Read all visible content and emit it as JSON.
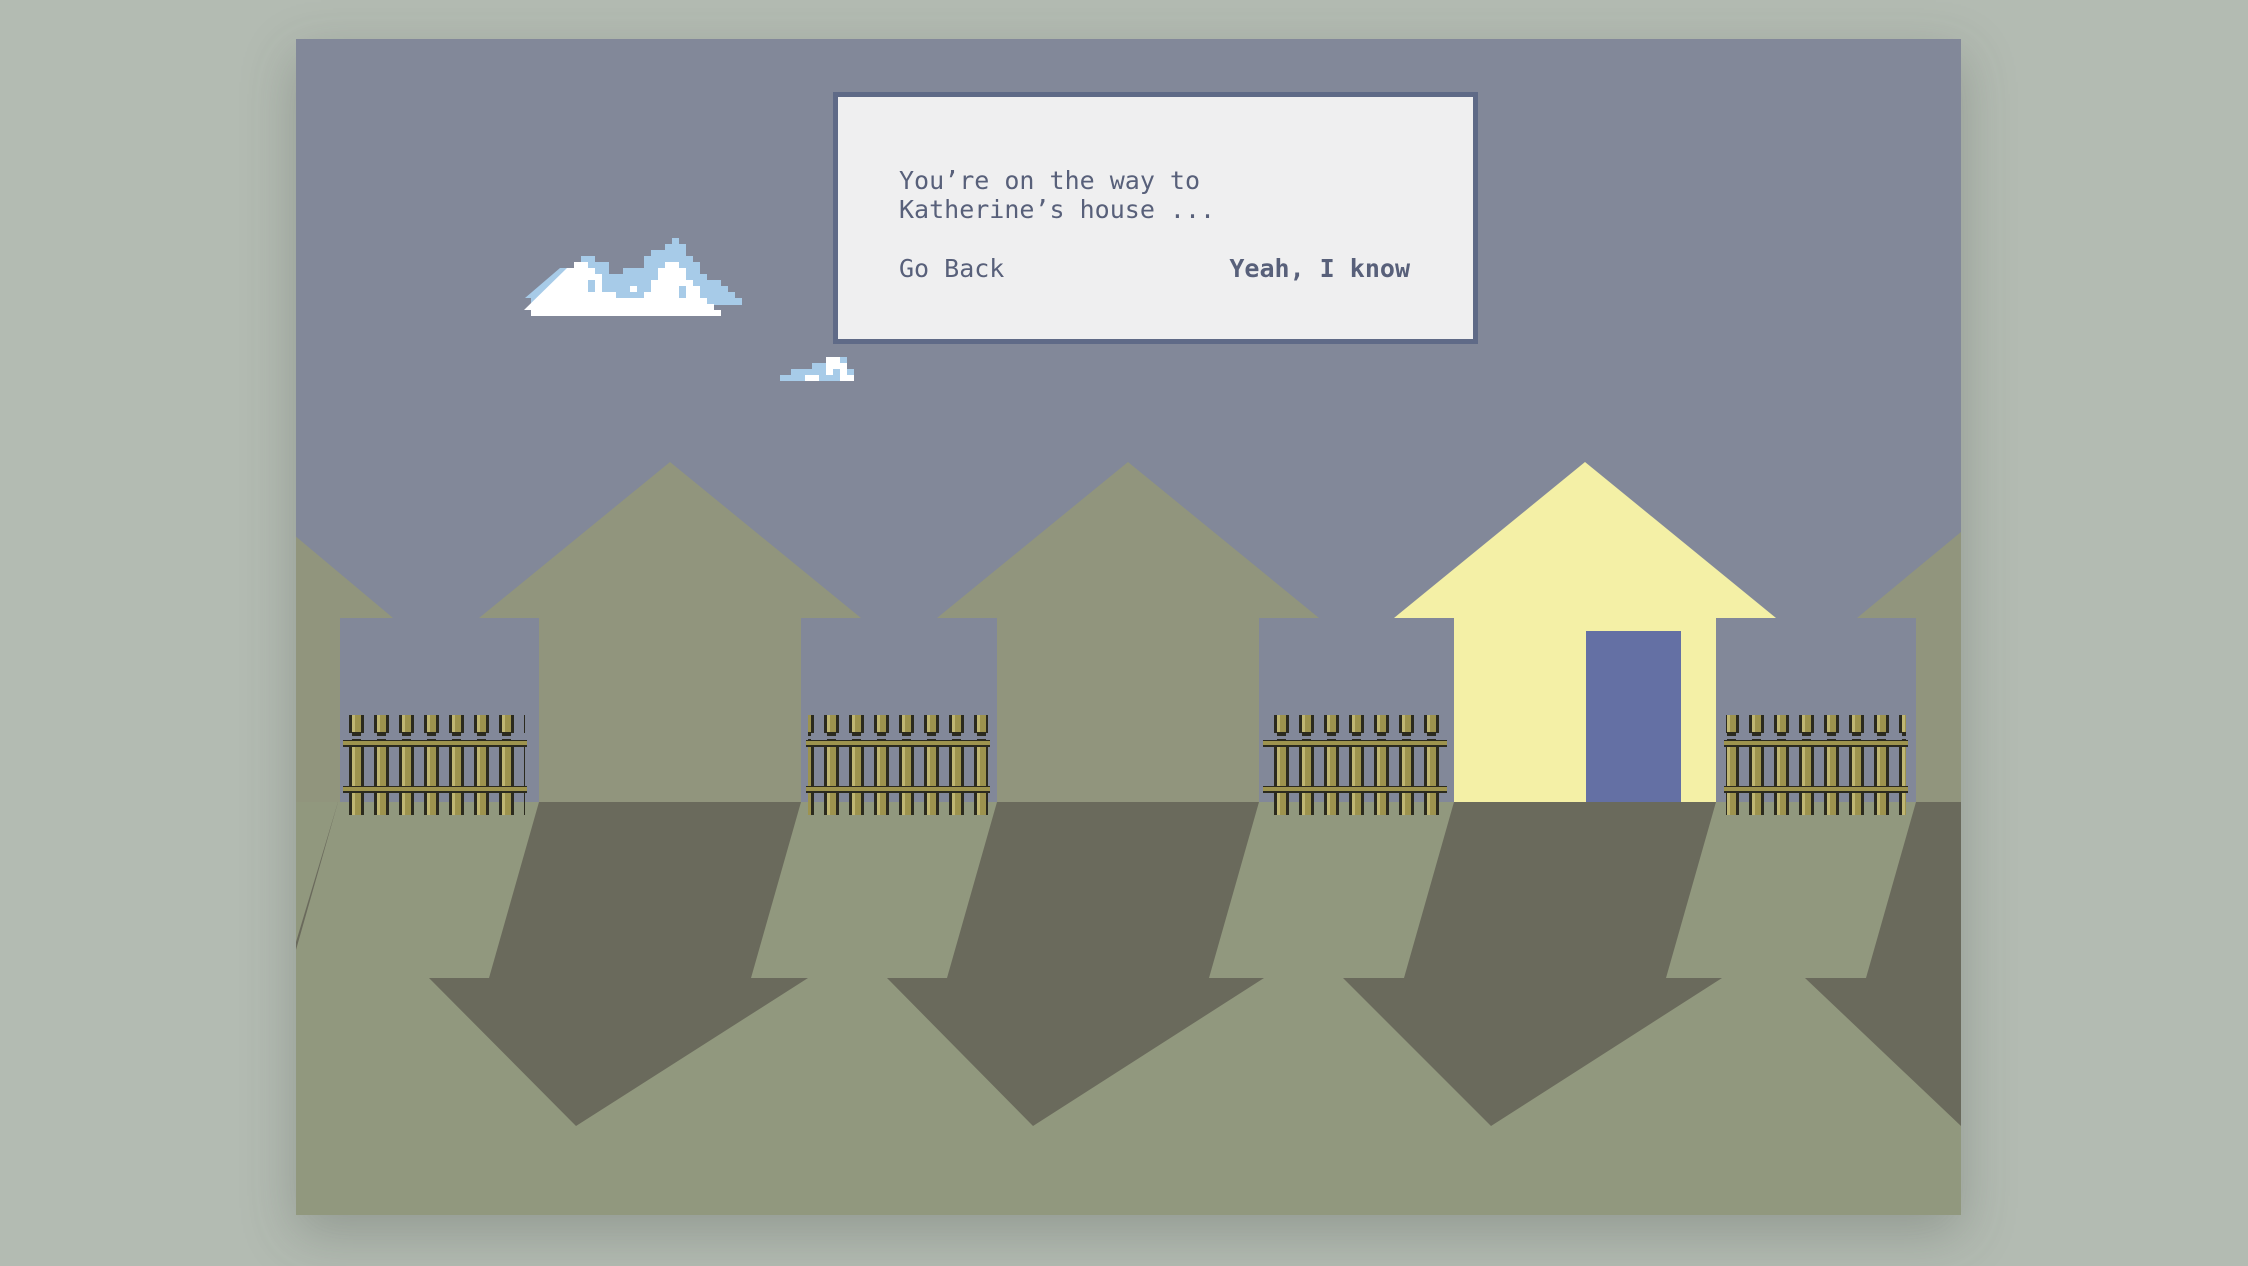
{
  "dialog": {
    "message": "You’re on the way to Katherine’s house ...",
    "go_back_label": "Go Back",
    "confirm_label": "Yeah, I know"
  },
  "scene": {
    "sky_color": "#828899",
    "house_color_inactive": "#91957d",
    "house_color_active": "#f4f0a6",
    "door_color": "#6470a4",
    "ground_light": "#91987e",
    "ground_dark": "#6a6a5c",
    "fence_color": "#9d934e",
    "cloud_color": "#ffffff",
    "cloud_shade": "#a7cbe8",
    "visible_houses": 4,
    "highlighted_house": 3
  },
  "icons": {
    "cloud": "cloud-icon",
    "fence": "fence-icon"
  }
}
